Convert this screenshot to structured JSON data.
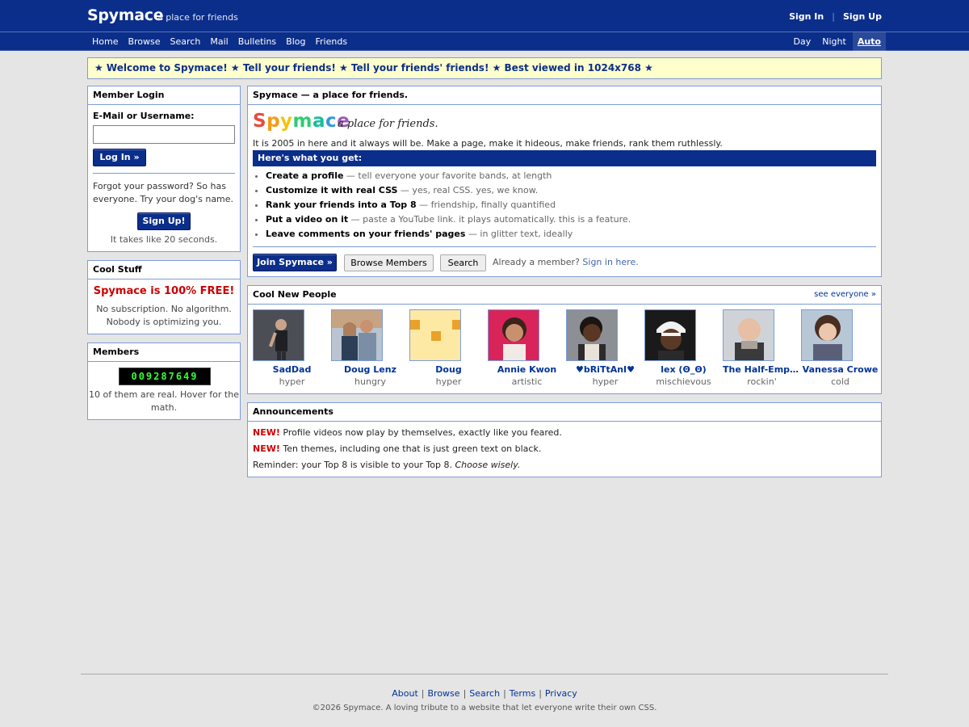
{
  "header": {
    "logo": "Spymace",
    "tagline": "a place for friends",
    "sign_in": "Sign In",
    "separator": "|",
    "sign_up": "Sign Up"
  },
  "nav": [
    "Home",
    "Browse",
    "Search",
    "Mail",
    "Bulletins",
    "Blog",
    "Friends"
  ],
  "themes": {
    "day": "Day",
    "night": "Night",
    "auto": "Auto",
    "active": "Auto"
  },
  "welcome": "★ Welcome to Spymace! ★ Tell your friends! ★ Tell your friends' friends! ★ Best viewed in 1024x768 ★",
  "login": {
    "title": "Member Login",
    "field_label": "E-Mail or Username:",
    "field_value": "",
    "login_button": "Log In »",
    "forgot_text": "Forgot your password? So has everyone. Try your dog's name.",
    "signup_button": "Sign Up!",
    "takes_text": "It takes like 20 seconds."
  },
  "cool_stuff": {
    "title": "Cool Stuff",
    "headline": "Spymace is 100% FREE!",
    "desc": "No subscription. No algorithm. Nobody is optimizing you."
  },
  "members": {
    "title": "Members",
    "counter": "009287649",
    "note": "10 of them are real. Hover for the math."
  },
  "hero": {
    "title": "Spymace — a place for friends.",
    "logo_letters": [
      "S",
      "p",
      "y",
      "m",
      "a",
      "c",
      "e"
    ],
    "logo_colors": [
      "#e74c3c",
      "#f39c12",
      "#f1c40f",
      "#2ecc71",
      "#1abc9c",
      "#3498db",
      "#9b59b6"
    ],
    "subtitle": "a place for friends.",
    "intro": "It is 2005 in here and it always will be. Make a page, make it hideous, make friends, rank them ruthlessly.",
    "bar_title": "Here's what you get:",
    "features": [
      {
        "title": "Create a profile",
        "desc": " — tell everyone your favorite bands, at length"
      },
      {
        "title": "Customize it with real CSS",
        "desc": " — yes, real CSS. yes, we know."
      },
      {
        "title": "Rank your friends into a Top 8",
        "desc": " — friendship, finally quantified"
      },
      {
        "title": "Put a video on it",
        "desc": " — paste a YouTube link. it plays automatically. this is a feature."
      },
      {
        "title": "Leave comments on your friends' pages",
        "desc": " — in glitter text, ideally"
      }
    ],
    "join_button": "Join Spymace »",
    "browse_button": "Browse Members",
    "search_button": "Search",
    "already_text": "Already a member?",
    "sign_in_link": "Sign in here."
  },
  "people": {
    "title": "Cool New People",
    "see_all": "see everyone »",
    "list": [
      {
        "name": "SadDad",
        "mood": "hyper",
        "avatar": "photo"
      },
      {
        "name": "Doug Lenz",
        "mood": "hungry",
        "avatar": "photo"
      },
      {
        "name": "Doug",
        "mood": "hyper",
        "avatar": "identicon"
      },
      {
        "name": "Annie Kwon",
        "mood": "artistic",
        "avatar": "photo"
      },
      {
        "name": "♥bRiTtAnI♥",
        "mood": "hyper",
        "avatar": "photo"
      },
      {
        "name": "lex (Θ_Θ)",
        "mood": "mischievous",
        "avatar": "photo"
      },
      {
        "name": "The Half-Empt...",
        "mood": "rockin'",
        "avatar": "photo"
      },
      {
        "name": "Vanessa Crowe",
        "mood": "cold",
        "avatar": "photo"
      }
    ]
  },
  "announcements": {
    "title": "Announcements",
    "new_label": "NEW!",
    "line1": "Profile videos now play by themselves, exactly like you feared.",
    "line2": "Ten themes, including one that is just green text on black.",
    "line3": "Reminder: your Top 8 is visible to your Top 8.",
    "line3_em": "Choose wisely."
  },
  "footer": {
    "links": [
      "About",
      "Browse",
      "Search",
      "Terms",
      "Privacy"
    ],
    "separator": "|",
    "copyright": "©2026 Spymace. A loving tribute to a website that let everyone write their own CSS."
  },
  "colors": {
    "header_bg": "#0b2e8a",
    "box_border": "#7d9cd6",
    "welcome_bg": "#ffffcc",
    "new_red": "#cc0000",
    "counter_green": "#33ff33"
  }
}
